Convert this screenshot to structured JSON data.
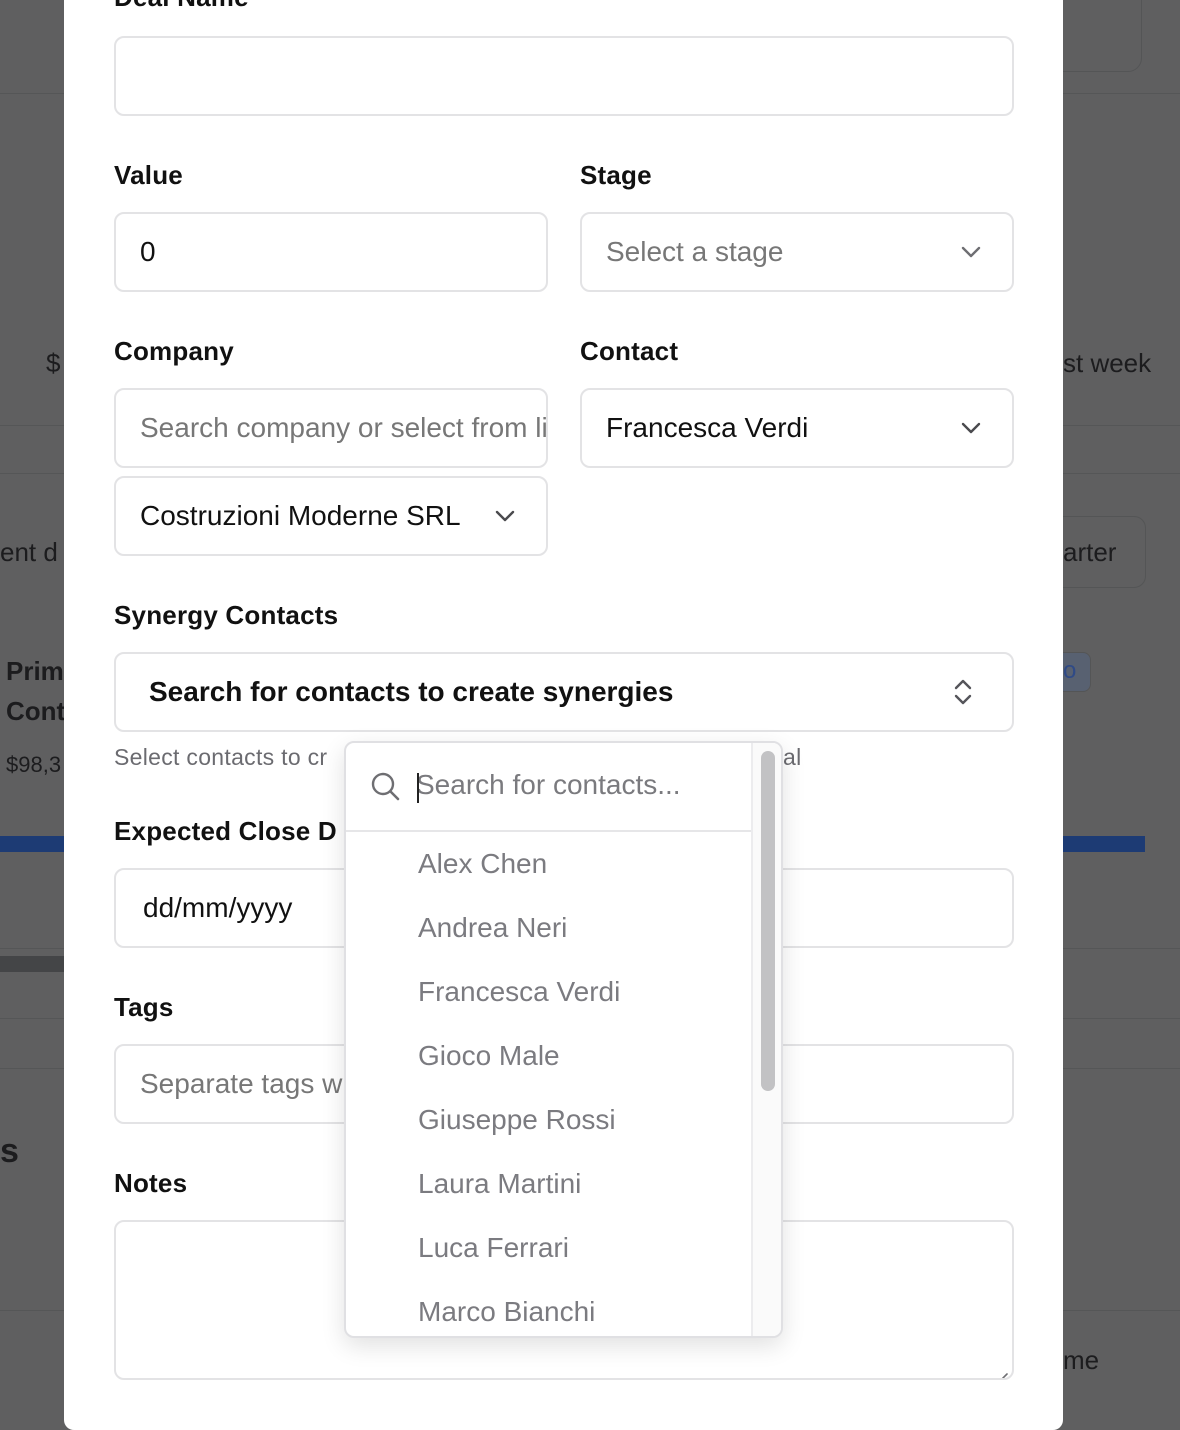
{
  "background": {
    "fragments": [
      "$",
      "st week",
      "ent d",
      "arter",
      "Prim",
      "Cont",
      "$98,3",
      "s",
      "me",
      "o"
    ],
    "accent_bar_color": "#1d3b74"
  },
  "form": {
    "deal_name_label": "Deal Name",
    "deal_name_value": "",
    "value_label": "Value",
    "value_value": "0",
    "stage_label": "Stage",
    "stage_placeholder": "Select a stage",
    "company_label": "Company",
    "company_search_placeholder": "Search company or select from list",
    "company_selected": "Costruzioni Moderne SRL",
    "contact_label": "Contact",
    "contact_selected": "Francesca Verdi",
    "synergy_label": "Synergy Contacts",
    "synergy_trigger": "Search for contacts to create synergies",
    "synergy_helper_left": "Select contacts to cr",
    "synergy_helper_right": "al",
    "close_date_label": "Expected Close D",
    "close_date_placeholder": "dd/mm/yyyy",
    "tags_label": "Tags",
    "tags_placeholder": "Separate tags w",
    "notes_label": "Notes",
    "notes_value": ""
  },
  "contact_dropdown": {
    "search_placeholder": "Search for contacts...",
    "items": [
      "Alex Chen",
      "Andrea Neri",
      "Francesca Verdi",
      "Gioco Male",
      "Giuseppe Rossi",
      "Laura Martini",
      "Luca Ferrari",
      "Marco Bianchi"
    ]
  }
}
